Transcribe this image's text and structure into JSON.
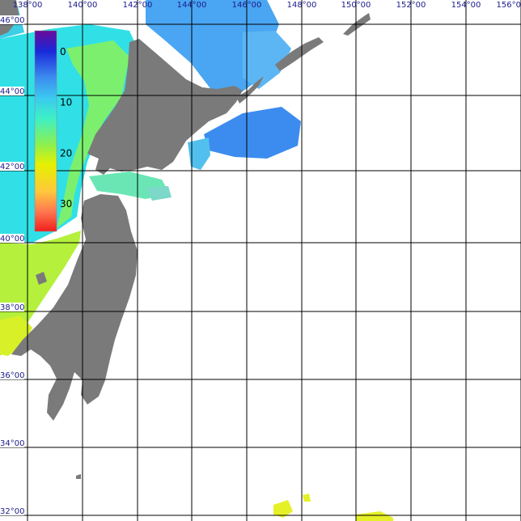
{
  "map": {
    "colors": {
      "land": "#7a7a7a",
      "grid": "#000000",
      "no_data": "#ffffff",
      "tick_text": "#1a1a8c"
    },
    "longitude_ticks": [
      "138°00",
      "140°00",
      "142°00",
      "144°00",
      "146°00",
      "148°00",
      "150°00",
      "152°00",
      "154°00",
      "156°0"
    ],
    "latitude_ticks": [
      "46°00",
      "44°00",
      "42°00",
      "40°00",
      "38°00",
      "36°00",
      "34°00",
      "32°00"
    ],
    "legend": {
      "labels": [
        "0",
        "10",
        "20",
        "30"
      ],
      "values": [
        0,
        10,
        20,
        30
      ],
      "range": [
        0,
        30
      ],
      "stops": [
        {
          "value": 0,
          "color": "#6a0a9a"
        },
        {
          "value": 3,
          "color": "#1a28d8"
        },
        {
          "value": 7,
          "color": "#3c8cf0"
        },
        {
          "value": 10,
          "color": "#3cc8f0"
        },
        {
          "value": 13,
          "color": "#3cf0c8"
        },
        {
          "value": 17,
          "color": "#8cf050"
        },
        {
          "value": 20,
          "color": "#e6f000"
        },
        {
          "value": 24,
          "color": "#ffc83c"
        },
        {
          "value": 27,
          "color": "#ff7850"
        },
        {
          "value": 30,
          "color": "#f01e1e"
        }
      ]
    }
  }
}
